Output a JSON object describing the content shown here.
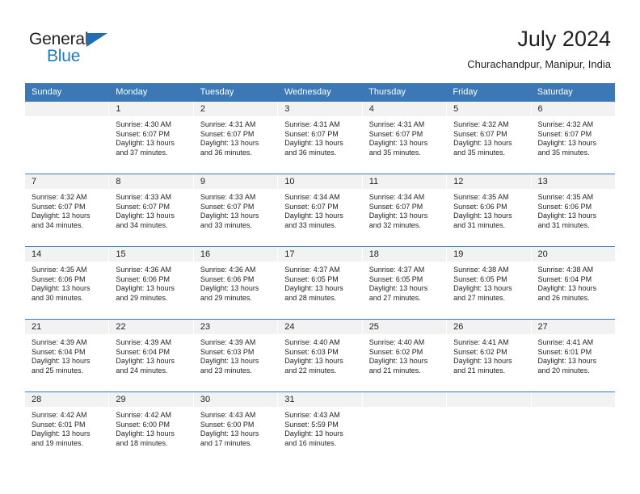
{
  "brand": {
    "name_part1": "General",
    "name_part2": "Blue",
    "logo_icon": "triangle-icon",
    "color_dark": "#231f20",
    "color_blue": "#1f7ac4"
  },
  "header": {
    "title": "July 2024",
    "subtitle": "Churachandpur, Manipur, India"
  },
  "theme": {
    "header_bg": "#3b78b5",
    "daynum_bg": "#f2f2f2",
    "text": "#231f20"
  },
  "weekdays": [
    "Sunday",
    "Monday",
    "Tuesday",
    "Wednesday",
    "Thursday",
    "Friday",
    "Saturday"
  ],
  "weeks": [
    [
      {
        "day": "",
        "sunrise": "",
        "sunset": "",
        "daylight1": "",
        "daylight2": ""
      },
      {
        "day": "1",
        "sunrise": "Sunrise: 4:30 AM",
        "sunset": "Sunset: 6:07 PM",
        "daylight1": "Daylight: 13 hours",
        "daylight2": "and 37 minutes."
      },
      {
        "day": "2",
        "sunrise": "Sunrise: 4:31 AM",
        "sunset": "Sunset: 6:07 PM",
        "daylight1": "Daylight: 13 hours",
        "daylight2": "and 36 minutes."
      },
      {
        "day": "3",
        "sunrise": "Sunrise: 4:31 AM",
        "sunset": "Sunset: 6:07 PM",
        "daylight1": "Daylight: 13 hours",
        "daylight2": "and 36 minutes."
      },
      {
        "day": "4",
        "sunrise": "Sunrise: 4:31 AM",
        "sunset": "Sunset: 6:07 PM",
        "daylight1": "Daylight: 13 hours",
        "daylight2": "and 35 minutes."
      },
      {
        "day": "5",
        "sunrise": "Sunrise: 4:32 AM",
        "sunset": "Sunset: 6:07 PM",
        "daylight1": "Daylight: 13 hours",
        "daylight2": "and 35 minutes."
      },
      {
        "day": "6",
        "sunrise": "Sunrise: 4:32 AM",
        "sunset": "Sunset: 6:07 PM",
        "daylight1": "Daylight: 13 hours",
        "daylight2": "and 35 minutes."
      }
    ],
    [
      {
        "day": "7",
        "sunrise": "Sunrise: 4:32 AM",
        "sunset": "Sunset: 6:07 PM",
        "daylight1": "Daylight: 13 hours",
        "daylight2": "and 34 minutes."
      },
      {
        "day": "8",
        "sunrise": "Sunrise: 4:33 AM",
        "sunset": "Sunset: 6:07 PM",
        "daylight1": "Daylight: 13 hours",
        "daylight2": "and 34 minutes."
      },
      {
        "day": "9",
        "sunrise": "Sunrise: 4:33 AM",
        "sunset": "Sunset: 6:07 PM",
        "daylight1": "Daylight: 13 hours",
        "daylight2": "and 33 minutes."
      },
      {
        "day": "10",
        "sunrise": "Sunrise: 4:34 AM",
        "sunset": "Sunset: 6:07 PM",
        "daylight1": "Daylight: 13 hours",
        "daylight2": "and 33 minutes."
      },
      {
        "day": "11",
        "sunrise": "Sunrise: 4:34 AM",
        "sunset": "Sunset: 6:07 PM",
        "daylight1": "Daylight: 13 hours",
        "daylight2": "and 32 minutes."
      },
      {
        "day": "12",
        "sunrise": "Sunrise: 4:35 AM",
        "sunset": "Sunset: 6:06 PM",
        "daylight1": "Daylight: 13 hours",
        "daylight2": "and 31 minutes."
      },
      {
        "day": "13",
        "sunrise": "Sunrise: 4:35 AM",
        "sunset": "Sunset: 6:06 PM",
        "daylight1": "Daylight: 13 hours",
        "daylight2": "and 31 minutes."
      }
    ],
    [
      {
        "day": "14",
        "sunrise": "Sunrise: 4:35 AM",
        "sunset": "Sunset: 6:06 PM",
        "daylight1": "Daylight: 13 hours",
        "daylight2": "and 30 minutes."
      },
      {
        "day": "15",
        "sunrise": "Sunrise: 4:36 AM",
        "sunset": "Sunset: 6:06 PM",
        "daylight1": "Daylight: 13 hours",
        "daylight2": "and 29 minutes."
      },
      {
        "day": "16",
        "sunrise": "Sunrise: 4:36 AM",
        "sunset": "Sunset: 6:06 PM",
        "daylight1": "Daylight: 13 hours",
        "daylight2": "and 29 minutes."
      },
      {
        "day": "17",
        "sunrise": "Sunrise: 4:37 AM",
        "sunset": "Sunset: 6:05 PM",
        "daylight1": "Daylight: 13 hours",
        "daylight2": "and 28 minutes."
      },
      {
        "day": "18",
        "sunrise": "Sunrise: 4:37 AM",
        "sunset": "Sunset: 6:05 PM",
        "daylight1": "Daylight: 13 hours",
        "daylight2": "and 27 minutes."
      },
      {
        "day": "19",
        "sunrise": "Sunrise: 4:38 AM",
        "sunset": "Sunset: 6:05 PM",
        "daylight1": "Daylight: 13 hours",
        "daylight2": "and 27 minutes."
      },
      {
        "day": "20",
        "sunrise": "Sunrise: 4:38 AM",
        "sunset": "Sunset: 6:04 PM",
        "daylight1": "Daylight: 13 hours",
        "daylight2": "and 26 minutes."
      }
    ],
    [
      {
        "day": "21",
        "sunrise": "Sunrise: 4:39 AM",
        "sunset": "Sunset: 6:04 PM",
        "daylight1": "Daylight: 13 hours",
        "daylight2": "and 25 minutes."
      },
      {
        "day": "22",
        "sunrise": "Sunrise: 4:39 AM",
        "sunset": "Sunset: 6:04 PM",
        "daylight1": "Daylight: 13 hours",
        "daylight2": "and 24 minutes."
      },
      {
        "day": "23",
        "sunrise": "Sunrise: 4:39 AM",
        "sunset": "Sunset: 6:03 PM",
        "daylight1": "Daylight: 13 hours",
        "daylight2": "and 23 minutes."
      },
      {
        "day": "24",
        "sunrise": "Sunrise: 4:40 AM",
        "sunset": "Sunset: 6:03 PM",
        "daylight1": "Daylight: 13 hours",
        "daylight2": "and 22 minutes."
      },
      {
        "day": "25",
        "sunrise": "Sunrise: 4:40 AM",
        "sunset": "Sunset: 6:02 PM",
        "daylight1": "Daylight: 13 hours",
        "daylight2": "and 21 minutes."
      },
      {
        "day": "26",
        "sunrise": "Sunrise: 4:41 AM",
        "sunset": "Sunset: 6:02 PM",
        "daylight1": "Daylight: 13 hours",
        "daylight2": "and 21 minutes."
      },
      {
        "day": "27",
        "sunrise": "Sunrise: 4:41 AM",
        "sunset": "Sunset: 6:01 PM",
        "daylight1": "Daylight: 13 hours",
        "daylight2": "and 20 minutes."
      }
    ],
    [
      {
        "day": "28",
        "sunrise": "Sunrise: 4:42 AM",
        "sunset": "Sunset: 6:01 PM",
        "daylight1": "Daylight: 13 hours",
        "daylight2": "and 19 minutes."
      },
      {
        "day": "29",
        "sunrise": "Sunrise: 4:42 AM",
        "sunset": "Sunset: 6:00 PM",
        "daylight1": "Daylight: 13 hours",
        "daylight2": "and 18 minutes."
      },
      {
        "day": "30",
        "sunrise": "Sunrise: 4:43 AM",
        "sunset": "Sunset: 6:00 PM",
        "daylight1": "Daylight: 13 hours",
        "daylight2": "and 17 minutes."
      },
      {
        "day": "31",
        "sunrise": "Sunrise: 4:43 AM",
        "sunset": "Sunset: 5:59 PM",
        "daylight1": "Daylight: 13 hours",
        "daylight2": "and 16 minutes."
      },
      {
        "day": "",
        "sunrise": "",
        "sunset": "",
        "daylight1": "",
        "daylight2": ""
      },
      {
        "day": "",
        "sunrise": "",
        "sunset": "",
        "daylight1": "",
        "daylight2": ""
      },
      {
        "day": "",
        "sunrise": "",
        "sunset": "",
        "daylight1": "",
        "daylight2": ""
      }
    ]
  ]
}
